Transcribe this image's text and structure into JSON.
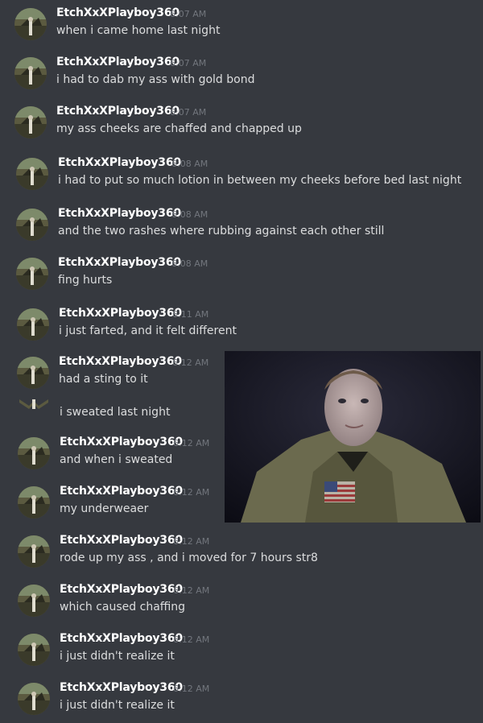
{
  "messages": [
    {
      "username": "EtchXxXPlayboy360",
      "time": "6:07 AM",
      "text": "when i came home last night"
    },
    {
      "username": "EtchXxXPlayboy360",
      "time": "6:07 AM",
      "text": "i had to dab my ass with gold bond"
    },
    {
      "username": "EtchXxXPlayboy360",
      "time": "6:07 AM",
      "text": "my ass cheeks are chaffed and chapped up"
    },
    {
      "username": "EtchXxXPlayboy360",
      "time": "6:08 AM",
      "text": "i had to put so much lotion in between my cheeks before bed last night"
    },
    {
      "username": "EtchXxXPlayboy360",
      "time": "6:08 AM",
      "text": "and the two rashes where rubbing against each other still"
    },
    {
      "username": "EtchXxXPlayboy360",
      "time": "6:08 AM",
      "text": "fing hurts"
    },
    {
      "username": "EtchXxXPlayboy360",
      "time": "6:11 AM",
      "text": "i just farted, and it felt different"
    },
    {
      "username": "EtchXxXPlayboy360",
      "time": "6:12 AM",
      "text": "had a sting to it",
      "continuation": "i sweated last night"
    },
    {
      "username": "EtchXxXPlayboy360",
      "time": "6:12 AM",
      "text": "and when i sweated"
    },
    {
      "username": "EtchXxXPlayboy360",
      "time": "6:12 AM",
      "text": "my underweaer"
    },
    {
      "username": "EtchXxXPlayboy360",
      "time": "6:12 AM",
      "text": "rode up my ass , and i moved for 7 hours str8"
    },
    {
      "username": "EtchXxXPlayboy360",
      "time": "6:12 AM",
      "text": "which caused chaffing"
    },
    {
      "username": "EtchXxXPlayboy360",
      "time": "6:12 AM",
      "text": "i just didn't realize it"
    },
    {
      "username": "EtchXxXPlayboy360",
      "time": "6:12 AM",
      "text": "i just didn't realize it"
    }
  ],
  "colors": {
    "background": "#36393f",
    "username": "#ffffff",
    "timestamp": "#72767d",
    "message_text": "#dcddde"
  }
}
